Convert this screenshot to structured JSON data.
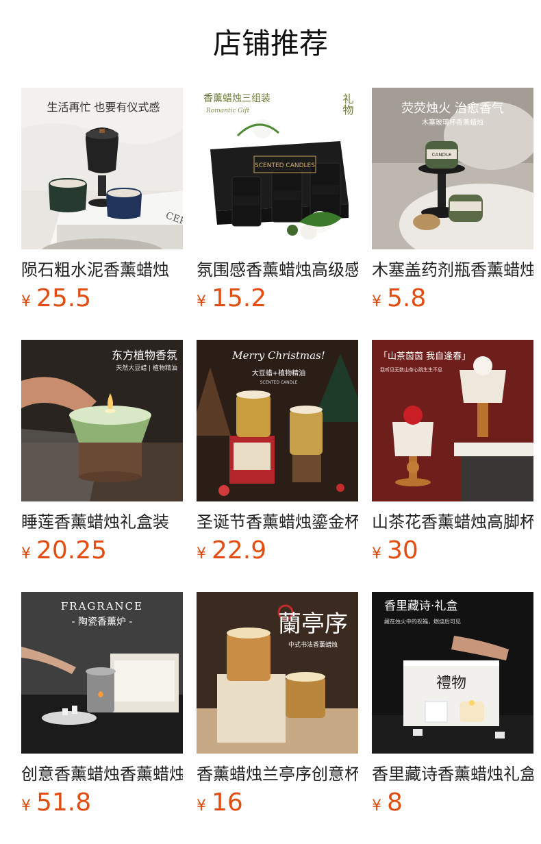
{
  "header": {
    "title": "店铺推荐"
  },
  "currency": "¥",
  "products": [
    {
      "name": "陨石粗水泥香薰蜡烛",
      "price": "25.5",
      "image": {
        "icon": "candle-photo",
        "caption": "生活再忙  也要有仪式感",
        "subcaption": "",
        "label": "CERE"
      }
    },
    {
      "name": "氛围感香薰蜡烛高级感",
      "price": "15.2",
      "image": {
        "icon": "candle-gift-box-photo",
        "caption": "香薰蜡烛三组装",
        "subcaption": "Romantic Gift",
        "label": "SCENTED CANDLES",
        "side": "礼物"
      }
    },
    {
      "name": "木塞盖药剂瓶香薰蜡烛",
      "price": "5.8",
      "image": {
        "icon": "candle-jar-photo",
        "caption": "荧荧烛火 治愈香气",
        "subcaption": "木塞玻璃杯香薰蜡烛",
        "label": "CANDLE"
      }
    },
    {
      "name": "睡莲香薰蜡烛礼盒装",
      "price": "20.25",
      "image": {
        "icon": "lit-candle-photo",
        "caption": "东方植物香氛",
        "subcaption": "天然大豆蜡 | 植物精油"
      }
    },
    {
      "name": "圣诞节香薰蜡烛鎏金杯",
      "price": "22.9",
      "image": {
        "icon": "christmas-candle-photo",
        "caption": "Merry Christmas!",
        "subcaption": "大豆蜡+植物精油",
        "label": "SCENTED CANDLE"
      }
    },
    {
      "name": "山茶花香薰蜡烛高脚杯",
      "price": "30",
      "image": {
        "icon": "camellia-candle-photo",
        "caption": "「山茶茵茵 我自逢春」",
        "subcaption": "我听见无数山茶心跳生生不息"
      }
    },
    {
      "name": "创意香薰蜡烛香薰蜡烛炉",
      "price": "51.8",
      "image": {
        "icon": "ceramic-burner-photo",
        "caption": "FRAGRANCE",
        "subcaption": "- 陶瓷香薰炉 -"
      }
    },
    {
      "name": "香薰蜡烛兰亭序创意杯",
      "price": "16",
      "image": {
        "icon": "lanting-candle-photo",
        "caption": "蘭亭序",
        "subcaption": "中式书法香薰蜡烛"
      }
    },
    {
      "name": "香里藏诗香薰蜡烛礼盒",
      "price": "8",
      "image": {
        "icon": "poetry-gift-box-photo",
        "caption": "香里藏诗·礼盒",
        "subcaption": "藏在烛火中的祝福，燃烧后可见",
        "label": "禮物"
      }
    }
  ]
}
